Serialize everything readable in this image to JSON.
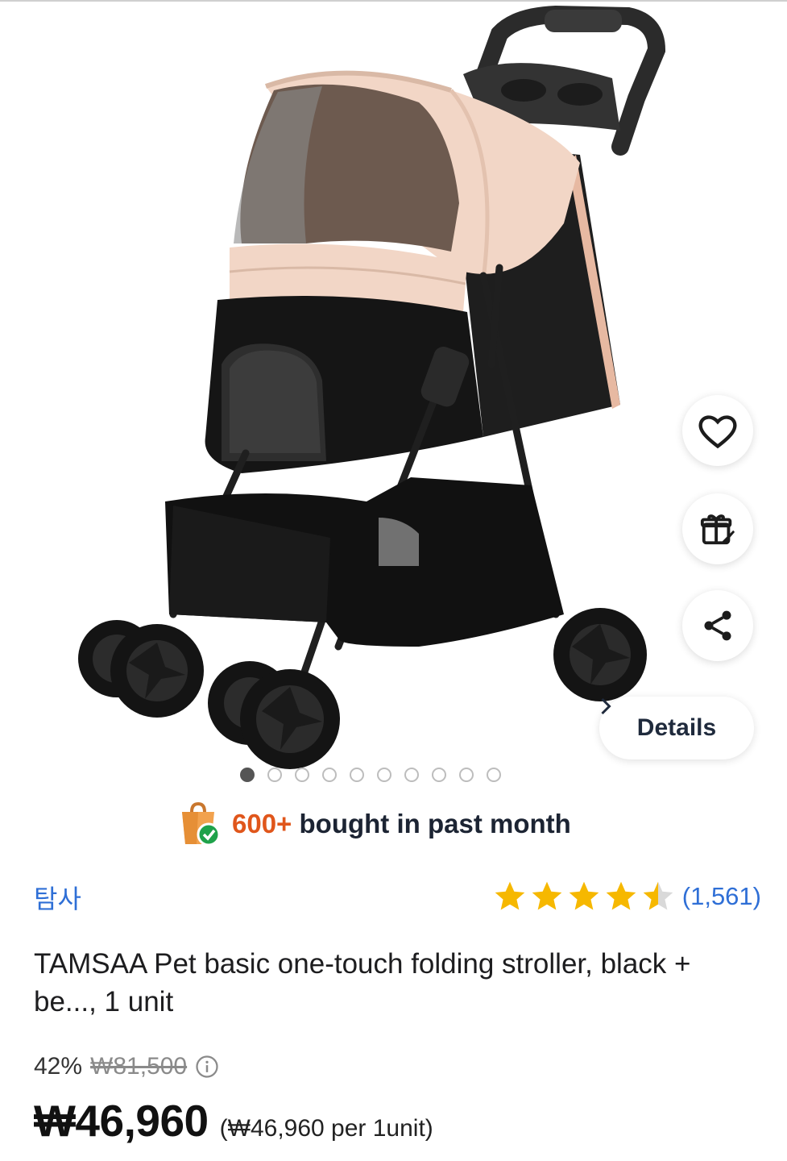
{
  "image_carousel": {
    "total_dots": 10,
    "active_index": 0,
    "actions": {
      "favorite_icon": "heart-icon",
      "gift_icon": "gift-icon",
      "share_icon": "share-icon"
    },
    "details_label": "Details"
  },
  "bought_banner": {
    "count": "600+",
    "text": "bought in past month",
    "icon": "shopping-bag-check-icon"
  },
  "brand": "탐사",
  "rating": {
    "stars": 4.5,
    "review_count": "(1,561)"
  },
  "product_title": "TAMSAA Pet basic one-touch folding stroller, black + be..., 1 unit",
  "price": {
    "discount": "42%",
    "original": "₩81,500",
    "current": "₩46,960",
    "per_unit": "(₩46,960 per 1unit)"
  },
  "colors": {
    "accent_blue": "#2f6fd6",
    "highlight_orange": "#e0561b",
    "star_yellow": "#f6b800"
  }
}
